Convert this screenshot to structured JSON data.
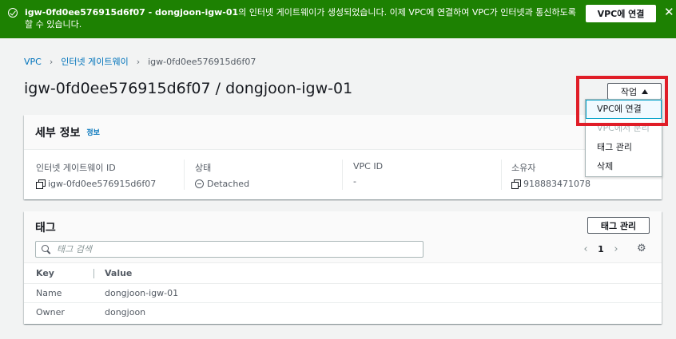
{
  "flash": {
    "message_bold": "igw-0fd0ee576915d6f07 - dongjoon-igw-01",
    "message_rest": "의 인터넷 게이트웨이가 생성되었습니다. 이제 VPC에 연결하여 VPC가 인터넷과 통신하도록 할 수 있습니다.",
    "connect_label": "VPC에 연결",
    "close_glyph": "✕"
  },
  "breadcrumb": {
    "items": [
      "VPC",
      "인터넷 게이트웨이",
      "igw-0fd0ee576915d6f07"
    ],
    "separator": "›"
  },
  "page_title": "igw-0fd0ee576915d6f07 / dongjoon-igw-01",
  "actions": {
    "label": "작업",
    "menu": [
      {
        "label": "VPC에 연결",
        "state": "active"
      },
      {
        "label": "VPC에서 분리",
        "state": "disabled"
      },
      {
        "label": "태그 관리",
        "state": "normal"
      },
      {
        "label": "삭제",
        "state": "normal"
      }
    ]
  },
  "details": {
    "title": "세부 정보",
    "info_link": "정보",
    "fields": [
      {
        "label": "인터넷 게이트웨이 ID",
        "value": "igw-0fd0ee576915d6f07",
        "icon": "copy-icon"
      },
      {
        "label": "상태",
        "value": "Detached",
        "icon": "status-detached-icon"
      },
      {
        "label": "VPC ID",
        "value": "-"
      },
      {
        "label": "소유자",
        "value": "918883471078",
        "icon": "copy-icon"
      }
    ]
  },
  "tags": {
    "title": "태그",
    "manage_label": "태그 관리",
    "search_placeholder": "태그 검색",
    "page": "1",
    "columns": [
      "Key",
      "Value"
    ],
    "rows": [
      {
        "key": "Name",
        "value": "dongjoon-igw-01"
      },
      {
        "key": "Owner",
        "value": "dongjoon"
      }
    ]
  },
  "colors": {
    "success_banner": "#1d8102",
    "link": "#0073bb",
    "highlight": "#e01d27"
  }
}
